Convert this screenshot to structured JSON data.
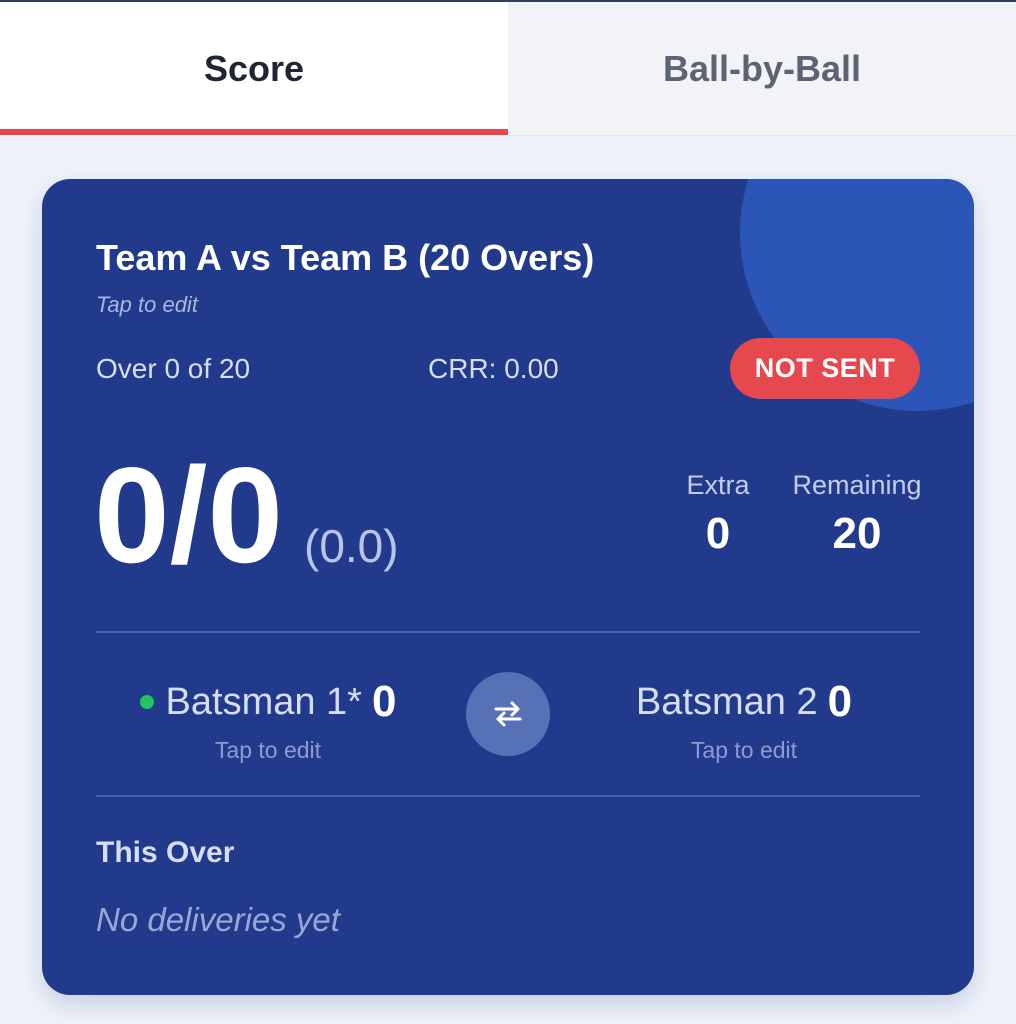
{
  "tabs": [
    {
      "label": "Score",
      "active": true
    },
    {
      "label": "Ball-by-Ball",
      "active": false
    }
  ],
  "match": {
    "title": "Team A vs Team B (20 Overs)",
    "title_hint": "Tap to edit",
    "over_info": "Over 0 of 20",
    "crr": "CRR: 0.00",
    "status_badge": "NOT SENT"
  },
  "score": {
    "runs_wickets": "0/0",
    "overs": "(0.0)",
    "extra_label": "Extra",
    "extra_value": "0",
    "remaining_label": "Remaining",
    "remaining_value": "20"
  },
  "batsmen": [
    {
      "name": "Batsman 1*",
      "runs": "0",
      "hint": "Tap to edit",
      "on_strike": true
    },
    {
      "name": "Batsman 2",
      "runs": "0",
      "hint": "Tap to edit",
      "on_strike": false
    }
  ],
  "swap_button": {
    "icon": "swap-arrows-icon",
    "glyph": "⇄"
  },
  "this_over": {
    "title": "This Over",
    "empty_text": "No deliveries yet"
  },
  "colors": {
    "card_background": "#213a8c",
    "accent_red": "#e5484d",
    "strike_indicator": "#22c55e",
    "page_background": "#eef3fb"
  }
}
